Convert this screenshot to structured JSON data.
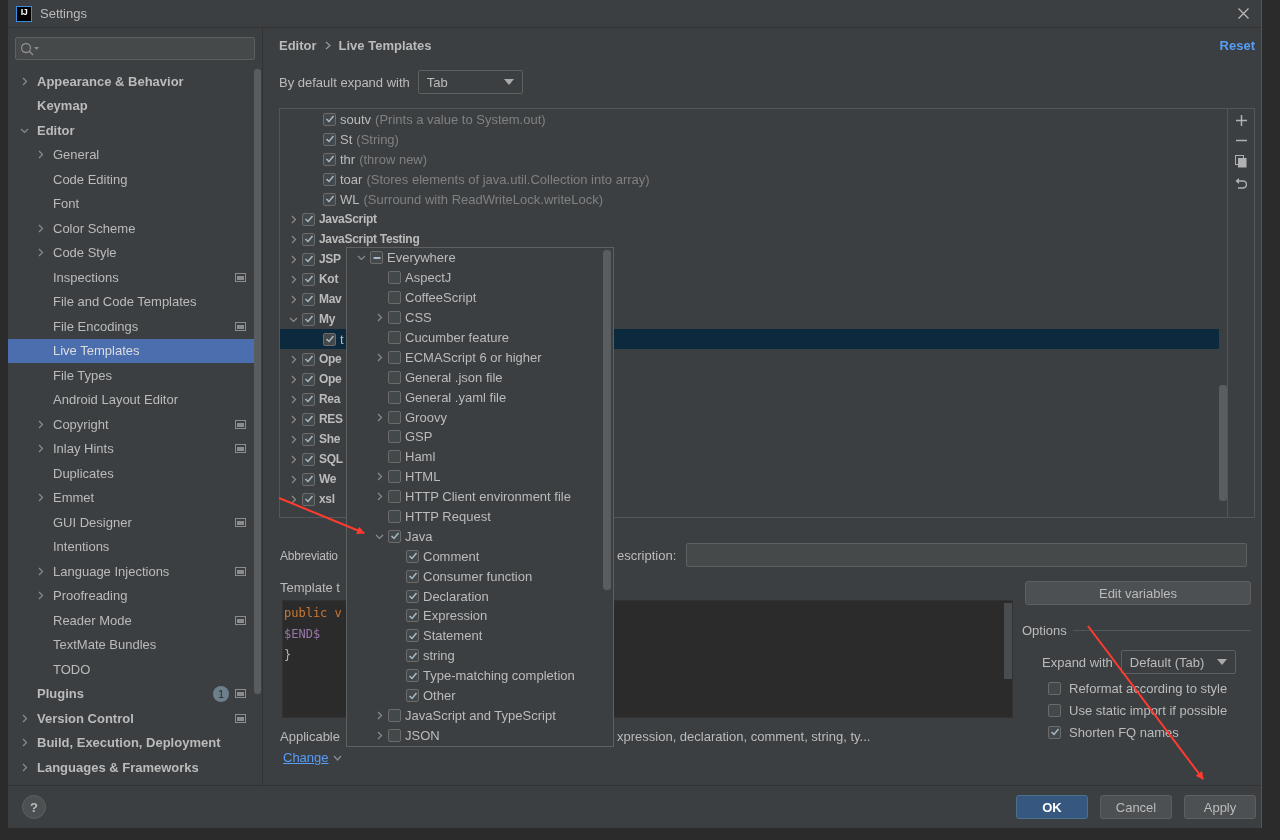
{
  "window": {
    "logo": "IJ",
    "title": "Settings"
  },
  "sidebar": {
    "items": [
      {
        "label": "Appearance & Behavior",
        "expanded": false,
        "selected": false,
        "scoped": false
      },
      {
        "label": "Keymap",
        "selected": false,
        "scoped": false
      },
      {
        "label": "Editor",
        "expanded": true,
        "selected": false,
        "scoped": false,
        "children": [
          {
            "label": "General",
            "expanded": false,
            "selected": false,
            "scoped": false
          },
          {
            "label": "Code Editing",
            "selected": false,
            "scoped": false
          },
          {
            "label": "Font",
            "selected": false,
            "scoped": false
          },
          {
            "label": "Color Scheme",
            "expanded": false,
            "selected": false,
            "scoped": false
          },
          {
            "label": "Code Style",
            "expanded": false,
            "selected": false,
            "scoped": false
          },
          {
            "label": "Inspections",
            "selected": false,
            "scoped": true
          },
          {
            "label": "File and Code Templates",
            "selected": false,
            "scoped": false
          },
          {
            "label": "File Encodings",
            "selected": false,
            "scoped": true
          },
          {
            "label": "Live Templates",
            "selected": true,
            "scoped": false
          },
          {
            "label": "File Types",
            "selected": false,
            "scoped": false
          },
          {
            "label": "Android Layout Editor",
            "selected": false,
            "scoped": false
          },
          {
            "label": "Copyright",
            "expanded": false,
            "selected": false,
            "scoped": true
          },
          {
            "label": "Inlay Hints",
            "expanded": false,
            "selected": false,
            "scoped": true
          },
          {
            "label": "Duplicates",
            "selected": false,
            "scoped": false
          },
          {
            "label": "Emmet",
            "expanded": false,
            "selected": false,
            "scoped": false
          },
          {
            "label": "GUI Designer",
            "selected": false,
            "scoped": true
          },
          {
            "label": "Intentions",
            "selected": false,
            "scoped": false
          },
          {
            "label": "Language Injections",
            "expanded": false,
            "selected": false,
            "scoped": true
          },
          {
            "label": "Proofreading",
            "expanded": false,
            "selected": false,
            "scoped": false
          },
          {
            "label": "Reader Mode",
            "selected": false,
            "scoped": true
          },
          {
            "label": "TextMate Bundles",
            "selected": false,
            "scoped": false
          },
          {
            "label": "TODO",
            "selected": false,
            "scoped": false
          }
        ]
      },
      {
        "label": "Plugins",
        "badge": "1",
        "selected": false,
        "scoped": true
      },
      {
        "label": "Version Control",
        "expanded": false,
        "selected": false,
        "scoped": true
      },
      {
        "label": "Build, Execution, Deployment",
        "expanded": false,
        "selected": false,
        "scoped": false
      },
      {
        "label": "Languages & Frameworks",
        "expanded": false,
        "selected": false,
        "scoped": false
      }
    ]
  },
  "breadcrumb": [
    "Editor",
    "Live Templates"
  ],
  "reset_link": "Reset",
  "expand_setting": {
    "label": "By default expand with",
    "value": "Tab"
  },
  "template_tree": {
    "scrolled_children": [
      {
        "abbreviation": "soutv",
        "description": "(Prints a value to System.out)",
        "checked": true,
        "selected": false
      },
      {
        "abbreviation": "St",
        "description": "(String)",
        "checked": true,
        "selected": false
      },
      {
        "abbreviation": "thr",
        "description": "(throw new)",
        "checked": true,
        "selected": false
      },
      {
        "abbreviation": "toar",
        "description": "(Stores elements of java.util.Collection into array)",
        "checked": true,
        "selected": false
      },
      {
        "abbreviation": "WL",
        "description": "(Surround with ReadWriteLock.writeLock)",
        "checked": true,
        "selected": false
      }
    ],
    "groups": [
      {
        "name": "JavaScript",
        "checked": true,
        "expanded": false
      },
      {
        "name": "JavaScript Testing",
        "checked": true,
        "expanded": false
      },
      {
        "name": "JSP",
        "checked": true,
        "expanded": false
      },
      {
        "name": "Kot",
        "checked": true,
        "expanded": false
      },
      {
        "name": "Mav",
        "checked": true,
        "expanded": false
      },
      {
        "name": "My",
        "checked": true,
        "expanded": true,
        "children": [
          {
            "abbreviation": "t",
            "checked": true,
            "selected": true
          }
        ]
      },
      {
        "name": "Ope",
        "checked": true,
        "expanded": false
      },
      {
        "name": "Ope",
        "checked": true,
        "expanded": false
      },
      {
        "name": "Rea",
        "checked": true,
        "expanded": false
      },
      {
        "name": "RES",
        "checked": true,
        "expanded": false
      },
      {
        "name": "She",
        "checked": true,
        "expanded": false
      },
      {
        "name": "SQL",
        "checked": true,
        "expanded": false
      },
      {
        "name": "We",
        "checked": true,
        "expanded": false
      },
      {
        "name": "xsl",
        "checked": true,
        "expanded": false
      }
    ]
  },
  "context_popup": {
    "items": [
      {
        "label": "Everywhere",
        "checked": false,
        "partial": true,
        "expanded": true,
        "children": [
          {
            "label": "AspectJ",
            "checked": false,
            "partial": false
          },
          {
            "label": "CoffeeScript",
            "checked": false,
            "partial": false
          },
          {
            "label": "CSS",
            "checked": false,
            "partial": false,
            "expanded": false
          },
          {
            "label": "Cucumber feature",
            "checked": false,
            "partial": false
          },
          {
            "label": "ECMAScript 6 or higher",
            "checked": false,
            "partial": false,
            "expanded": false
          },
          {
            "label": "General .json file",
            "checked": false,
            "partial": false
          },
          {
            "label": "General .yaml file",
            "checked": false,
            "partial": false
          },
          {
            "label": "Groovy",
            "checked": false,
            "partial": false,
            "expanded": false
          },
          {
            "label": "GSP",
            "checked": false,
            "partial": false
          },
          {
            "label": "Haml",
            "checked": false,
            "partial": false
          },
          {
            "label": "HTML",
            "checked": false,
            "partial": false,
            "expanded": false
          },
          {
            "label": "HTTP Client environment file",
            "checked": false,
            "partial": false,
            "expanded": false
          },
          {
            "label": "HTTP Request",
            "checked": false,
            "partial": false
          },
          {
            "label": "Java",
            "checked": true,
            "partial": false,
            "expanded": true,
            "children": [
              {
                "label": "Comment",
                "checked": true,
                "partial": false
              },
              {
                "label": "Consumer function",
                "checked": true,
                "partial": false
              },
              {
                "label": "Declaration",
                "checked": true,
                "partial": false
              },
              {
                "label": "Expression",
                "checked": true,
                "partial": false
              },
              {
                "label": "Statement",
                "checked": true,
                "partial": false
              },
              {
                "label": "string",
                "checked": true,
                "partial": false
              },
              {
                "label": "Type-matching completion",
                "checked": true,
                "partial": false
              },
              {
                "label": "Other",
                "checked": true,
                "partial": false
              }
            ]
          },
          {
            "label": "JavaScript and TypeScript",
            "checked": false,
            "partial": false,
            "expanded": false
          },
          {
            "label": "JSON",
            "checked": false,
            "partial": false,
            "expanded": false
          }
        ]
      }
    ]
  },
  "abbreviation": {
    "label": "Abbreviatio"
  },
  "description": {
    "label": "escription:"
  },
  "template_text": {
    "label": "Template t",
    "lines": [
      {
        "text": "public v",
        "kind": "keyword"
      },
      {
        "text": "$END$",
        "kind": "variable"
      },
      {
        "text": "}",
        "kind": "plain"
      }
    ]
  },
  "applicable": {
    "label": "Applicable",
    "text": "xpression, declaration, comment, string, ty..."
  },
  "change_link": "Change",
  "edit_variables_button": "Edit variables",
  "options": {
    "title": "Options",
    "expand_label": "Expand with",
    "expand_value": "Default (Tab)",
    "checkboxes": [
      {
        "label": "Reformat according to style",
        "checked": false
      },
      {
        "label": "Use static import if possible",
        "checked": false
      },
      {
        "label": "Shorten FQ names",
        "checked": true
      }
    ]
  },
  "help_button": "?",
  "buttons": [
    {
      "label": "OK",
      "kind": "primary"
    },
    {
      "label": "Cancel",
      "kind": "secondary"
    },
    {
      "label": "Apply",
      "kind": "secondary"
    }
  ]
}
